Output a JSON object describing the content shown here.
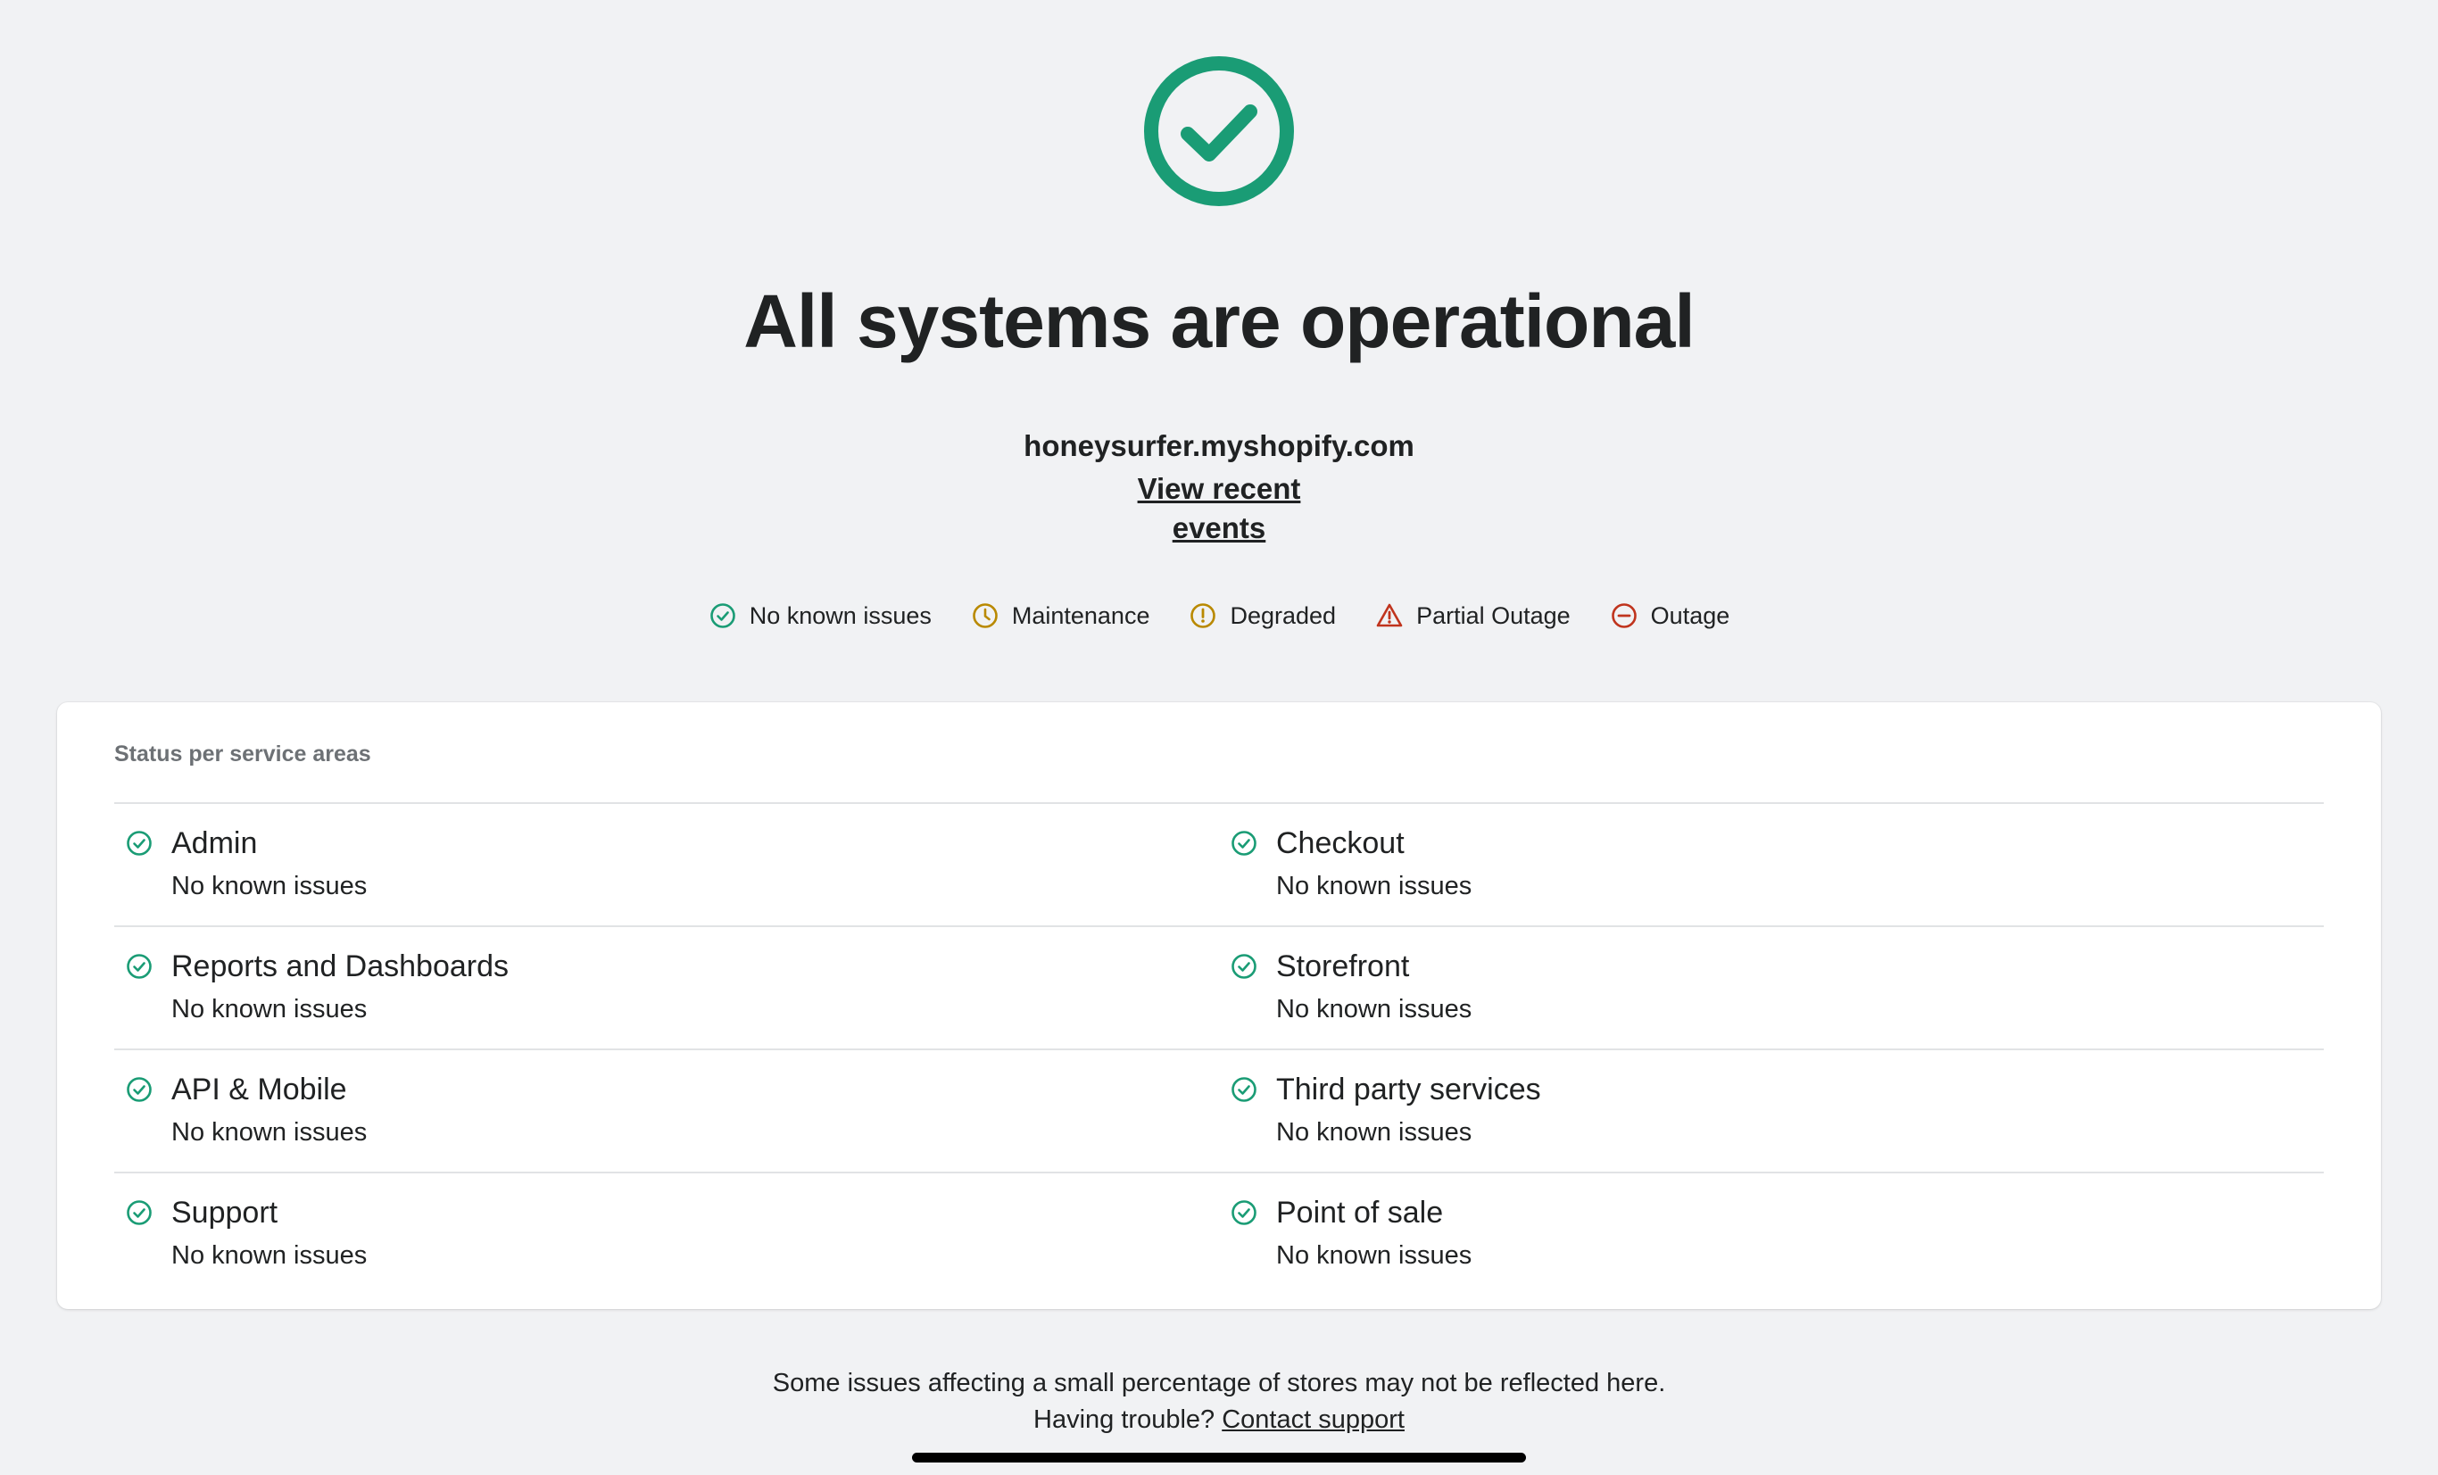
{
  "hero": {
    "icon": "check-circle-icon",
    "headline": "All systems are operational",
    "store_domain": "honeysurfer.myshopify.com",
    "events_link": "View recent events"
  },
  "legend": [
    {
      "icon": "check-circle-icon",
      "label": "No known issues",
      "color": "#1a9c75"
    },
    {
      "icon": "clock-icon",
      "label": "Maintenance",
      "color": "#b98900"
    },
    {
      "icon": "exclamation-circle-icon",
      "label": "Degraded",
      "color": "#b98900"
    },
    {
      "icon": "warning-triangle-icon",
      "label": "Partial Outage",
      "color": "#c0341d"
    },
    {
      "icon": "minus-circle-icon",
      "label": "Outage",
      "color": "#c0341d"
    }
  ],
  "services_card": {
    "title": "Status per service areas",
    "items": [
      {
        "name": "Admin",
        "status": "No known issues"
      },
      {
        "name": "Checkout",
        "status": "No known issues"
      },
      {
        "name": "Reports and Dashboards",
        "status": "No known issues"
      },
      {
        "name": "Storefront",
        "status": "No known issues"
      },
      {
        "name": "API & Mobile",
        "status": "No known issues"
      },
      {
        "name": "Third party services",
        "status": "No known issues"
      },
      {
        "name": "Support",
        "status": "No known issues"
      },
      {
        "name": "Point of sale",
        "status": "No known issues"
      }
    ]
  },
  "footer": {
    "note": "Some issues affecting a small percentage of stores may not be reflected here.",
    "help_prefix": "Having trouble?",
    "contact_link": "Contact support"
  },
  "colors": {
    "success": "#1a9c75",
    "background": "#f1f2f4",
    "text": "#202223"
  }
}
